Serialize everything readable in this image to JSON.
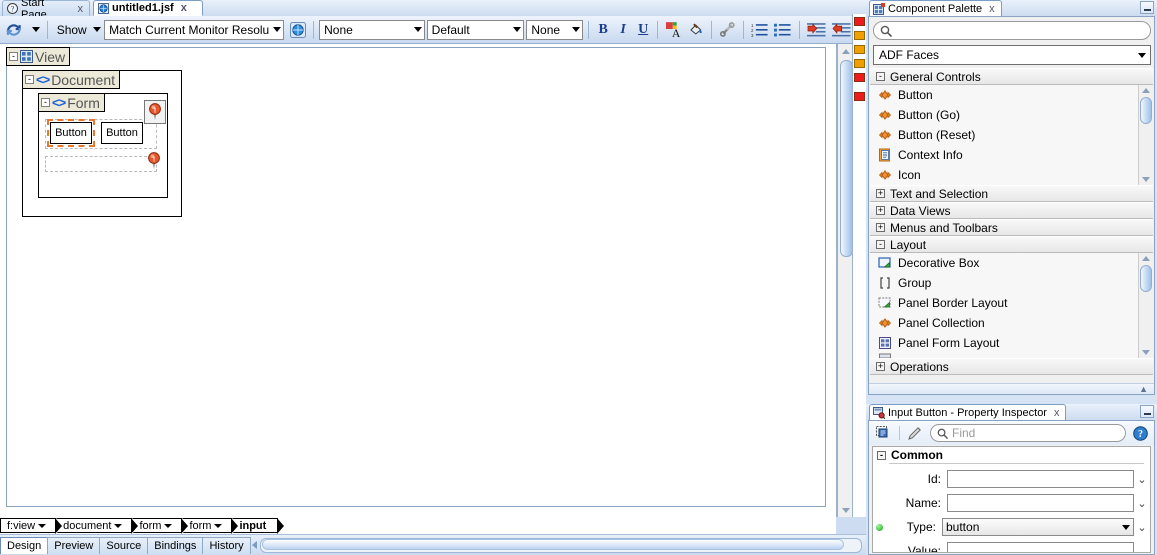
{
  "editor": {
    "tabs": [
      {
        "label": "Start Page",
        "icon": "help-page-icon",
        "active": false,
        "closable": true
      },
      {
        "label": "untitled1.jsf",
        "icon": "jsf-page-icon",
        "active": true,
        "closable": true
      }
    ],
    "toolbar": {
      "refresh_icon": "refresh-preview-icon",
      "refresh_dropdown": "dropdown-arrow",
      "show_label": "Show",
      "resolution_value": "Match Current Monitor Resolution",
      "browser_icon": "browser-preview-icon",
      "style_class_value": "None",
      "font_value": "Default",
      "size_value": "None",
      "bold_label": "B",
      "italic_label": "I",
      "underline_label": "U",
      "font_color_icon": "font-color-icon",
      "fill_color_icon": "fill-color-icon",
      "link_icon": "link-icon",
      "ordered_list_icon": "ordered-list-icon",
      "unordered_list_icon": "unordered-list-icon",
      "indent_icon": "indent-right-icon",
      "outdent_icon": "indent-left-icon"
    },
    "canvas": {
      "view_label": "View",
      "document_label": "Document",
      "form_label": "Form",
      "button1_label": "Button",
      "button2_label": "Button",
      "collapse_glyph": "-"
    },
    "breadcrumb": [
      "f:view",
      "document",
      "form",
      "form",
      "input"
    ],
    "bottom_tabs": [
      {
        "label": "Design",
        "selected": true
      },
      {
        "label": "Preview",
        "selected": false
      },
      {
        "label": "Source",
        "selected": false
      },
      {
        "label": "Bindings",
        "selected": false
      },
      {
        "label": "History",
        "selected": false
      }
    ]
  },
  "palette": {
    "title": "Component Palette",
    "close_label": "x",
    "search_placeholder": "",
    "library_value": "ADF Faces",
    "groups": [
      {
        "label": "General Controls",
        "expanded": true,
        "items": [
          {
            "label": "Button",
            "icon": "adf-component-icon"
          },
          {
            "label": "Button (Go)",
            "icon": "adf-component-icon"
          },
          {
            "label": "Button (Reset)",
            "icon": "adf-component-icon"
          },
          {
            "label": "Context Info",
            "icon": "context-info-icon"
          },
          {
            "label": "Icon",
            "icon": "adf-component-icon"
          }
        ]
      },
      {
        "label": "Text and Selection",
        "expanded": false,
        "items": []
      },
      {
        "label": "Data Views",
        "expanded": false,
        "items": []
      },
      {
        "label": "Menus and Toolbars",
        "expanded": false,
        "items": []
      },
      {
        "label": "Layout",
        "expanded": true,
        "items": [
          {
            "label": "Decorative Box",
            "icon": "decorative-box-icon"
          },
          {
            "label": "Group",
            "icon": "group-brackets-icon"
          },
          {
            "label": "Panel Border Layout",
            "icon": "panel-border-layout-icon"
          },
          {
            "label": "Panel Collection",
            "icon": "adf-component-icon"
          },
          {
            "label": "Panel Form Layout",
            "icon": "panel-form-layout-icon"
          }
        ]
      },
      {
        "label": "Operations",
        "expanded": false,
        "items": []
      }
    ]
  },
  "property_inspector": {
    "title": "Input Button - Property Inspector",
    "close_label": "x",
    "toolbar": {
      "select_icon": "selection-source-icon",
      "edit_icon": "pencil-edit-icon",
      "help_icon": "help-question-icon",
      "find_placeholder": "Find"
    },
    "section": {
      "label": "Common",
      "expanded": true,
      "rows": [
        {
          "label": "Id:",
          "value": "",
          "type": "text",
          "required": false
        },
        {
          "label": "Name:",
          "value": "",
          "type": "text",
          "required": false
        },
        {
          "label": "Type:",
          "value": "button",
          "type": "combo",
          "required": true
        },
        {
          "label": "Value:",
          "value": "",
          "type": "text",
          "required": false
        }
      ]
    }
  },
  "colors": {
    "accent": "#2b5fb8",
    "chrome": "#cddcf0",
    "error_marker": "#e81c1c",
    "warning_marker": "#f0a000",
    "selection_orange": "#e8762c",
    "tag_blue": "#1b5fd0"
  }
}
